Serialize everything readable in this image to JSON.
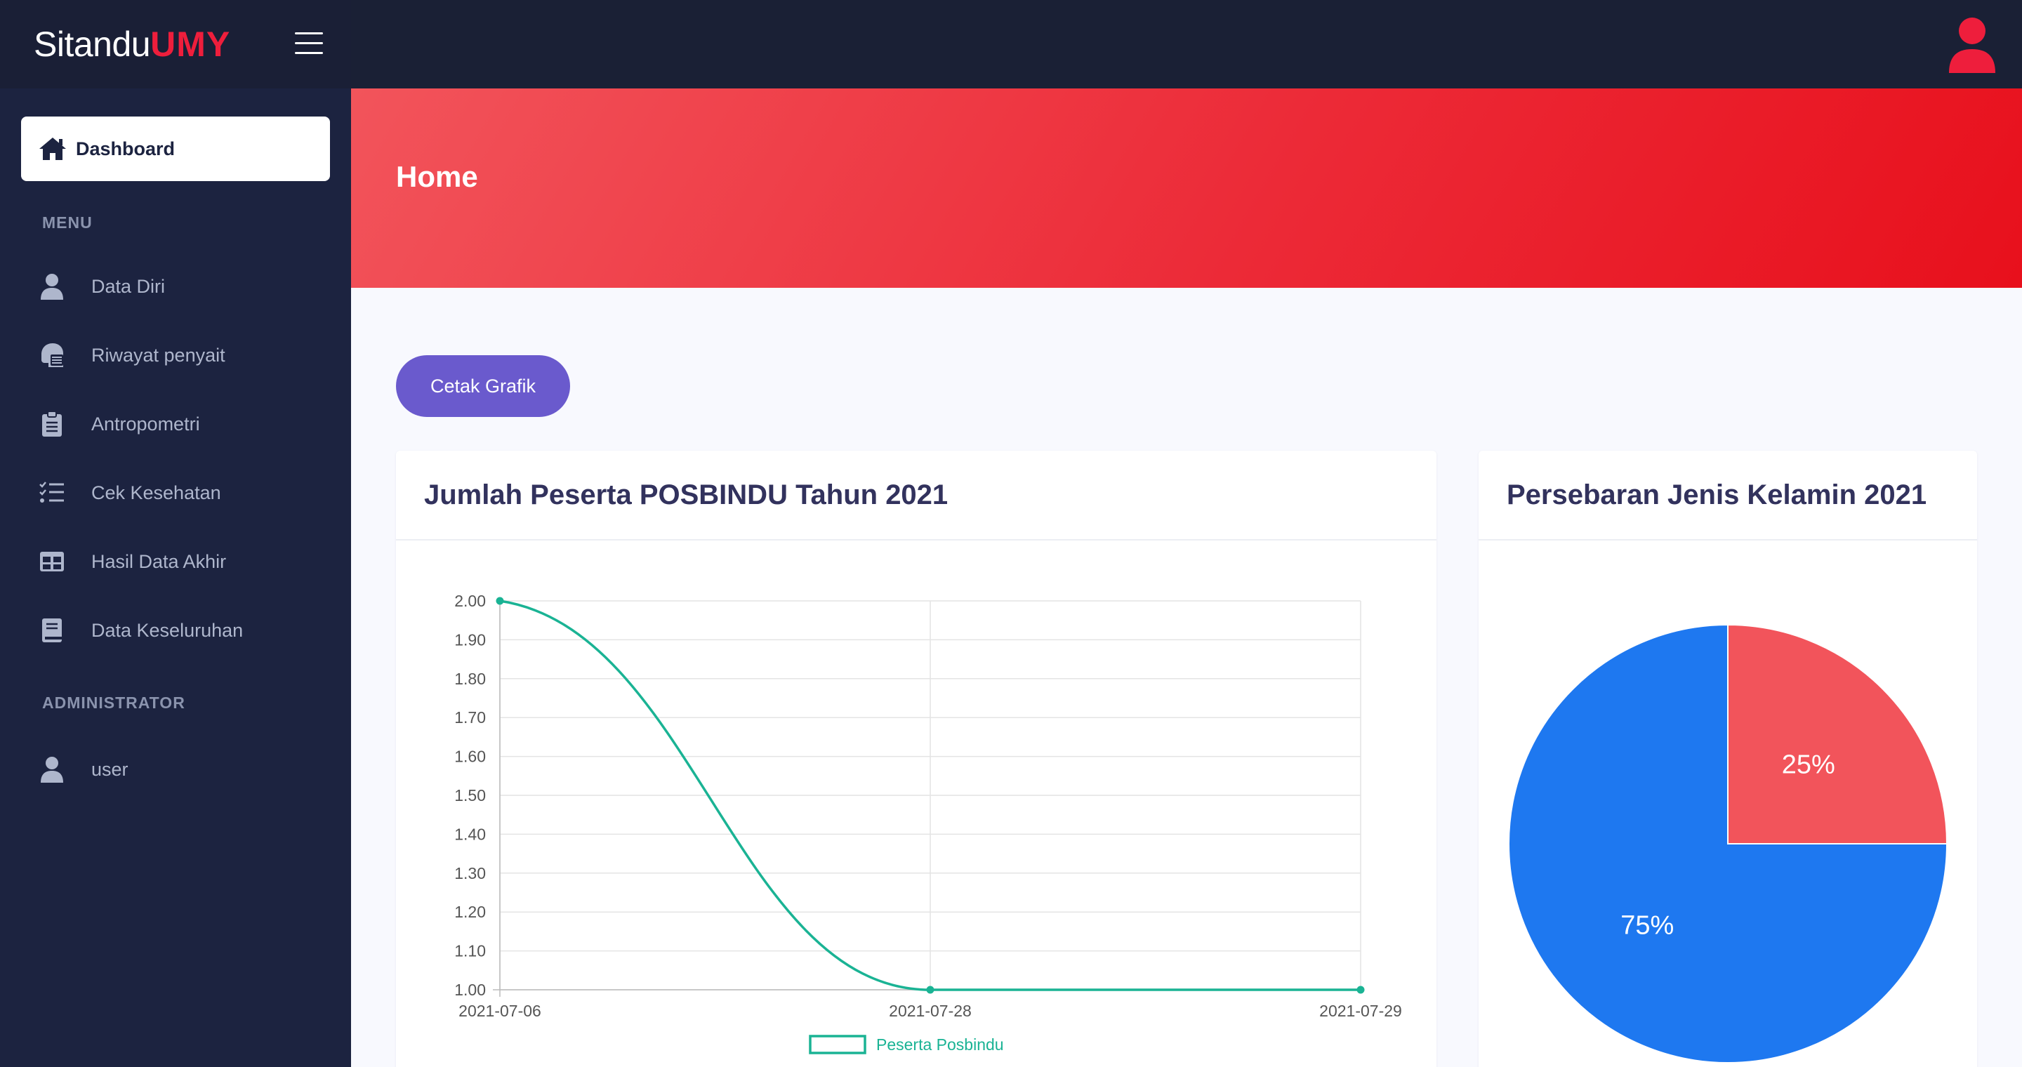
{
  "brand": {
    "name": "Sitandu",
    "accent": "UMY"
  },
  "sidebar": {
    "active_item": {
      "label": "Dashboard",
      "icon": "home-icon"
    },
    "sections": [
      {
        "title": "MENU"
      },
      {
        "title": "ADMINISTRATOR"
      }
    ],
    "items": [
      {
        "label": "Data Diri",
        "icon": "user-icon"
      },
      {
        "label": "Riwayat penyait",
        "icon": "head-side-mask-icon"
      },
      {
        "label": "Antropometri",
        "icon": "clipboard-list-icon"
      },
      {
        "label": "Cek Kesehatan",
        "icon": "tasks-icon"
      },
      {
        "label": "Hasil Data Akhir",
        "icon": "table-icon"
      },
      {
        "label": "Data Keseluruhan",
        "icon": "book-icon"
      },
      {
        "label": "user",
        "icon": "user-icon"
      }
    ]
  },
  "header": {
    "title": "Home"
  },
  "actions": {
    "print_chart_label": "Cetak Grafik"
  },
  "cards": {
    "line_title": "Jumlah Peserta POSBINDU Tahun 2021",
    "pie_title": "Persebaran Jenis Kelamin 2021"
  },
  "colors": {
    "accent_red": "#ee1e3c",
    "line_series": "#1ab394",
    "pie_red": "#f2545b",
    "pie_blue": "#1e78f0",
    "button_purple": "#6a5acd"
  },
  "chart_data": [
    {
      "type": "line",
      "title": "Jumlah Peserta POSBINDU Tahun 2021",
      "x": [
        "2021-07-06",
        "2021-07-28",
        "2021-07-29"
      ],
      "series": [
        {
          "name": "Peserta Posbindu",
          "values": [
            2,
            1,
            1
          ]
        }
      ],
      "yticks": [
        "2.00",
        "1.90",
        "1.80",
        "1.70",
        "1.60",
        "1.50",
        "1.40",
        "1.30",
        "1.20",
        "1.10",
        "1.00"
      ],
      "ylim": [
        1,
        2
      ],
      "grid": true,
      "legend": "bottom"
    },
    {
      "type": "pie",
      "title": "Persebaran Jenis Kelamin 2021",
      "slices": [
        {
          "value": 25,
          "label": "25%",
          "color": "#f2545b"
        },
        {
          "value": 75,
          "label": "75%",
          "color": "#1e78f0"
        }
      ],
      "legend": "bottom"
    }
  ]
}
